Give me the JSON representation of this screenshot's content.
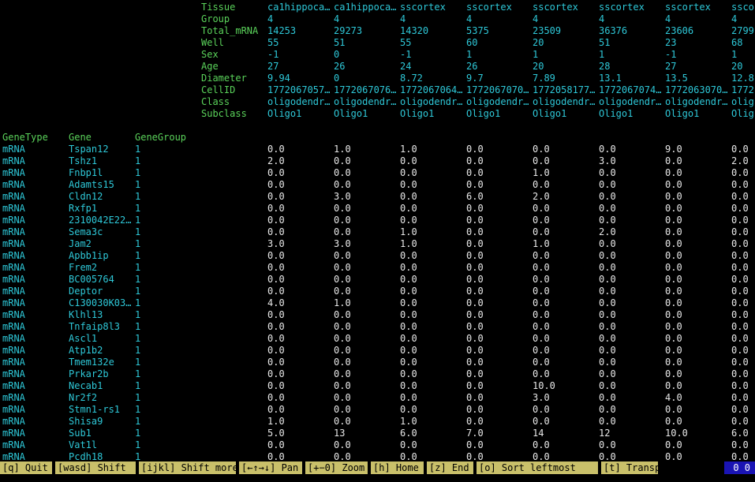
{
  "meta_labels": [
    "Tissue",
    "Group",
    "Total_mRNA",
    "Well",
    "Sex",
    "Age",
    "Diameter",
    "CellID",
    "Class",
    "Subclass"
  ],
  "columns": [
    {
      "Tissue": "ca1hippoca…",
      "Group": "4",
      "Total_mRNA": "14253",
      "Well": "55",
      "Sex": "-1",
      "Age": "27",
      "Diameter": "9.94",
      "CellID": "1772067057…",
      "Class": "oligodendr…",
      "Subclass": "Oligo1"
    },
    {
      "Tissue": "ca1hippoca…",
      "Group": "4",
      "Total_mRNA": "29273",
      "Well": "51",
      "Sex": "0",
      "Age": "26",
      "Diameter": "0",
      "CellID": "1772067076…",
      "Class": "oligodendr…",
      "Subclass": "Oligo1"
    },
    {
      "Tissue": "sscortex",
      "Group": "4",
      "Total_mRNA": "14320",
      "Well": "55",
      "Sex": "-1",
      "Age": "24",
      "Diameter": "8.72",
      "CellID": "1772067064…",
      "Class": "oligodendr…",
      "Subclass": "Oligo1"
    },
    {
      "Tissue": "sscortex",
      "Group": "4",
      "Total_mRNA": "5375",
      "Well": "60",
      "Sex": "1",
      "Age": "26",
      "Diameter": "9.7",
      "CellID": "1772067070…",
      "Class": "oligodendr…",
      "Subclass": "Oligo1"
    },
    {
      "Tissue": "sscortex",
      "Group": "4",
      "Total_mRNA": "23509",
      "Well": "20",
      "Sex": "1",
      "Age": "20",
      "Diameter": "7.89",
      "CellID": "1772058177…",
      "Class": "oligodendr…",
      "Subclass": "Oligo1"
    },
    {
      "Tissue": "sscortex",
      "Group": "4",
      "Total_mRNA": "36376",
      "Well": "51",
      "Sex": "1",
      "Age": "28",
      "Diameter": "13.1",
      "CellID": "1772067074…",
      "Class": "oligodendr…",
      "Subclass": "Oligo1"
    },
    {
      "Tissue": "sscortex",
      "Group": "4",
      "Total_mRNA": "23606",
      "Well": "23",
      "Sex": "-1",
      "Age": "27",
      "Diameter": "13.5",
      "CellID": "1772063070…",
      "Class": "oligodendr…",
      "Subclass": "Oligo1"
    },
    {
      "Tissue": "ssco",
      "Group": "4",
      "Total_mRNA": "2799",
      "Well": "68",
      "Sex": "1",
      "Age": "20",
      "Diameter": "12.8",
      "CellID": "1772",
      "Class": "olig",
      "Subclass": "Olig"
    }
  ],
  "row_headers": [
    "GeneType",
    "Gene",
    "GeneGroup"
  ],
  "rows": [
    {
      "type": "mRNA",
      "gene": "Tspan12",
      "group": "1",
      "values": [
        "0.0",
        "1.0",
        "1.0",
        "0.0",
        "0.0",
        "0.0",
        "9.0",
        "0.0"
      ]
    },
    {
      "type": "mRNA",
      "gene": "Tshz1",
      "group": "1",
      "values": [
        "2.0",
        "0.0",
        "0.0",
        "0.0",
        "0.0",
        "3.0",
        "0.0",
        "2.0"
      ]
    },
    {
      "type": "mRNA",
      "gene": "Fnbp1l",
      "group": "1",
      "values": [
        "0.0",
        "0.0",
        "0.0",
        "0.0",
        "1.0",
        "0.0",
        "0.0",
        "0.0"
      ]
    },
    {
      "type": "mRNA",
      "gene": "Adamts15",
      "group": "1",
      "values": [
        "0.0",
        "0.0",
        "0.0",
        "0.0",
        "0.0",
        "0.0",
        "0.0",
        "0.0"
      ]
    },
    {
      "type": "mRNA",
      "gene": "Cldn12",
      "group": "1",
      "values": [
        "0.0",
        "3.0",
        "0.0",
        "6.0",
        "2.0",
        "0.0",
        "0.0",
        "0.0"
      ]
    },
    {
      "type": "mRNA",
      "gene": "Rxfp1",
      "group": "1",
      "values": [
        "0.0",
        "0.0",
        "0.0",
        "0.0",
        "0.0",
        "0.0",
        "0.0",
        "0.0"
      ]
    },
    {
      "type": "mRNA",
      "gene": "2310042E22…",
      "group": "1",
      "values": [
        "0.0",
        "0.0",
        "0.0",
        "0.0",
        "0.0",
        "0.0",
        "0.0",
        "0.0"
      ]
    },
    {
      "type": "mRNA",
      "gene": "Sema3c",
      "group": "1",
      "values": [
        "0.0",
        "0.0",
        "1.0",
        "0.0",
        "0.0",
        "2.0",
        "0.0",
        "0.0"
      ]
    },
    {
      "type": "mRNA",
      "gene": "Jam2",
      "group": "1",
      "values": [
        "3.0",
        "3.0",
        "1.0",
        "0.0",
        "1.0",
        "0.0",
        "0.0",
        "0.0"
      ]
    },
    {
      "type": "mRNA",
      "gene": "Apbb1ip",
      "group": "1",
      "values": [
        "0.0",
        "0.0",
        "0.0",
        "0.0",
        "0.0",
        "0.0",
        "0.0",
        "0.0"
      ]
    },
    {
      "type": "mRNA",
      "gene": "Frem2",
      "group": "1",
      "values": [
        "0.0",
        "0.0",
        "0.0",
        "0.0",
        "0.0",
        "0.0",
        "0.0",
        "0.0"
      ]
    },
    {
      "type": "mRNA",
      "gene": "BC005764",
      "group": "1",
      "values": [
        "0.0",
        "0.0",
        "0.0",
        "0.0",
        "0.0",
        "0.0",
        "0.0",
        "0.0"
      ]
    },
    {
      "type": "mRNA",
      "gene": "Deptor",
      "group": "1",
      "values": [
        "0.0",
        "0.0",
        "0.0",
        "0.0",
        "0.0",
        "0.0",
        "0.0",
        "0.0"
      ]
    },
    {
      "type": "mRNA",
      "gene": "C130030K03…",
      "group": "1",
      "values": [
        "4.0",
        "1.0",
        "0.0",
        "0.0",
        "0.0",
        "0.0",
        "0.0",
        "0.0"
      ]
    },
    {
      "type": "mRNA",
      "gene": "Klhl13",
      "group": "1",
      "values": [
        "0.0",
        "0.0",
        "0.0",
        "0.0",
        "0.0",
        "0.0",
        "0.0",
        "0.0"
      ]
    },
    {
      "type": "mRNA",
      "gene": "Tnfaip8l3",
      "group": "1",
      "values": [
        "0.0",
        "0.0",
        "0.0",
        "0.0",
        "0.0",
        "0.0",
        "0.0",
        "0.0"
      ]
    },
    {
      "type": "mRNA",
      "gene": "Ascl1",
      "group": "1",
      "values": [
        "0.0",
        "0.0",
        "0.0",
        "0.0",
        "0.0",
        "0.0",
        "0.0",
        "0.0"
      ]
    },
    {
      "type": "mRNA",
      "gene": "Atp1b2",
      "group": "1",
      "values": [
        "0.0",
        "0.0",
        "0.0",
        "0.0",
        "0.0",
        "0.0",
        "0.0",
        "0.0"
      ]
    },
    {
      "type": "mRNA",
      "gene": "Tmem132e",
      "group": "1",
      "values": [
        "0.0",
        "0.0",
        "0.0",
        "0.0",
        "0.0",
        "0.0",
        "0.0",
        "0.0"
      ]
    },
    {
      "type": "mRNA",
      "gene": "Prkar2b",
      "group": "1",
      "values": [
        "0.0",
        "0.0",
        "0.0",
        "0.0",
        "0.0",
        "0.0",
        "0.0",
        "0.0"
      ]
    },
    {
      "type": "mRNA",
      "gene": "Necab1",
      "group": "1",
      "values": [
        "0.0",
        "0.0",
        "0.0",
        "0.0",
        "10.0",
        "0.0",
        "0.0",
        "0.0"
      ]
    },
    {
      "type": "mRNA",
      "gene": "Nr2f2",
      "group": "1",
      "values": [
        "0.0",
        "0.0",
        "0.0",
        "0.0",
        "3.0",
        "0.0",
        "4.0",
        "0.0"
      ]
    },
    {
      "type": "mRNA",
      "gene": "Stmn1-rs1",
      "group": "1",
      "values": [
        "0.0",
        "0.0",
        "0.0",
        "0.0",
        "0.0",
        "0.0",
        "0.0",
        "0.0"
      ]
    },
    {
      "type": "mRNA",
      "gene": "Shisa9",
      "group": "1",
      "values": [
        "1.0",
        "0.0",
        "1.0",
        "0.0",
        "0.0",
        "0.0",
        "0.0",
        "0.0"
      ]
    },
    {
      "type": "mRNA",
      "gene": "Sub1",
      "group": "1",
      "values": [
        "5.0",
        "13",
        "6.0",
        "7.0",
        "14",
        "12",
        "10.0",
        "6.0"
      ]
    },
    {
      "type": "mRNA",
      "gene": "Vat1l",
      "group": "1",
      "values": [
        "0.0",
        "0.0",
        "0.0",
        "0.0",
        "0.0",
        "0.0",
        "0.0",
        "0.0"
      ]
    },
    {
      "type": "mRNA",
      "gene": "Pcdh18",
      "group": "1",
      "values": [
        "0.0",
        "0.0",
        "0.0",
        "0.0",
        "0.0",
        "0.0",
        "0.0",
        "0.0"
      ]
    }
  ],
  "statusbar": {
    "keys": [
      {
        "name": "quit",
        "label": "[q] Quit"
      },
      {
        "name": "shift",
        "label": "[wasd] Shift"
      },
      {
        "name": "shift-more",
        "label": "[ijkl] Shift more"
      },
      {
        "name": "pan",
        "label": "[←↑→↓] Pan"
      },
      {
        "name": "zoom",
        "label": "[+−0] Zoom"
      },
      {
        "name": "home",
        "label": "[h] Home"
      },
      {
        "name": "end",
        "label": "[z] End"
      },
      {
        "name": "sort-leftmost",
        "label": "[o] Sort leftmost"
      },
      {
        "name": "transpose",
        "label": "[t] Transpose"
      }
    ],
    "position": "0 0"
  },
  "colors": {
    "header": "#5ad25a",
    "meta": "#2ec8d8",
    "values": "#e8e8e8",
    "keybar": "#c9c06a",
    "position": "#1a14b4"
  }
}
